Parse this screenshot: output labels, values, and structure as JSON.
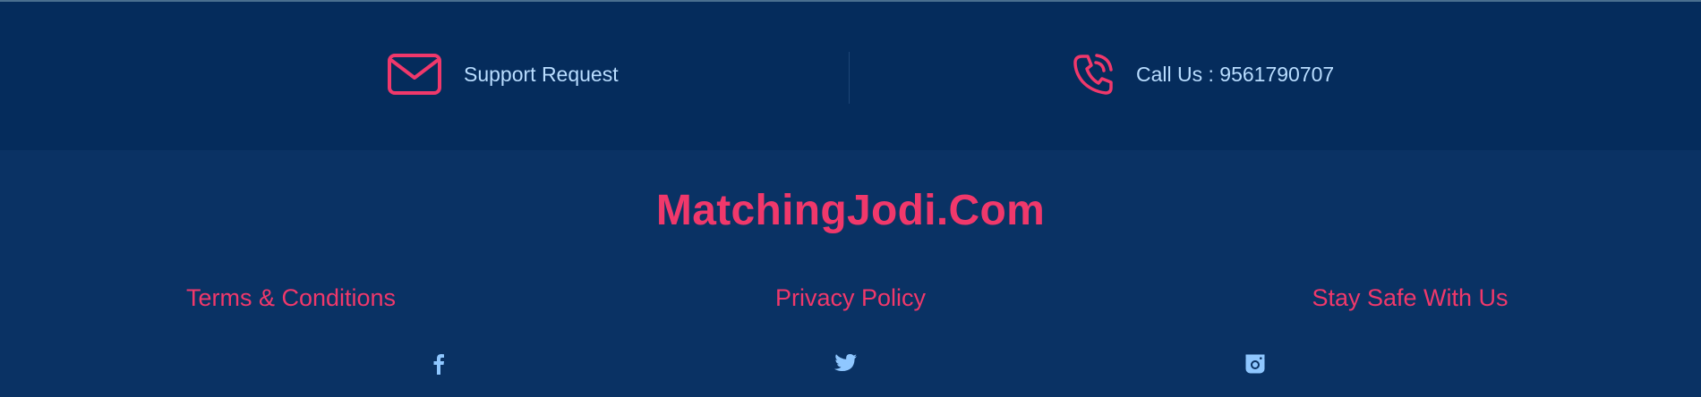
{
  "contact": {
    "support_label": "Support Request",
    "call_label": "Call Us : 9561790707"
  },
  "footer": {
    "brand": "MatchingJodi.Com",
    "links": [
      {
        "label": "Terms & Conditions"
      },
      {
        "label": "Privacy Policy"
      },
      {
        "label": "Stay Safe With Us"
      }
    ],
    "social": [
      "facebook-icon",
      "twitter-icon",
      "instagram-icon"
    ]
  },
  "colors": {
    "contact_bar_bg": "#052c5c",
    "footer_bg": "#0a3264",
    "accent": "#f0386b",
    "text_light": "#b9ddff",
    "icon_light": "#8fc7ff"
  }
}
